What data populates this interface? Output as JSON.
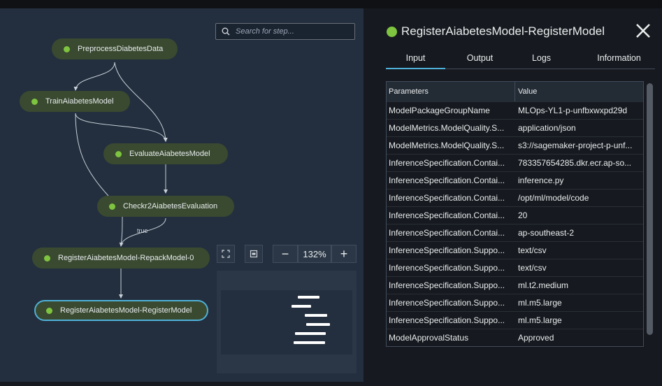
{
  "search": {
    "placeholder": "Search for step..."
  },
  "graph": {
    "nodes": [
      {
        "label": "PreprocessDiabetesData"
      },
      {
        "label": "TrainAiabetesModel"
      },
      {
        "label": "EvaluateAiabetesModel"
      },
      {
        "label": "Checkr2AiabetesEvaluation"
      },
      {
        "label": "RegisterAiabetesModel-RepackModel-0"
      },
      {
        "label": "RegisterAiabetesModel-RegisterModel"
      }
    ],
    "edge_label": "true",
    "status_color": "#7ec440",
    "selected_color": "#4fb0d8"
  },
  "controls": {
    "fit_icon": "fit-screen-icon",
    "center_icon": "center-icon",
    "zoom_out": "−",
    "zoom_value": "132%",
    "zoom_in": "+"
  },
  "panel": {
    "title": "RegisterAiabetesModel-RegisterModel",
    "status_icon": "success-dot",
    "close_icon": "close-icon",
    "tabs": [
      {
        "label": "Input",
        "active": true
      },
      {
        "label": "Output"
      },
      {
        "label": "Logs"
      },
      {
        "label": "Information"
      }
    ],
    "table": {
      "headers": [
        "Parameters",
        "Value"
      ],
      "rows": [
        [
          "ModelPackageGroupName",
          "MLOps-YL1-p-unfbxwxpd29d"
        ],
        [
          "ModelMetrics.ModelQuality.S...",
          "application/json"
        ],
        [
          "ModelMetrics.ModelQuality.S...",
          "s3://sagemaker-project-p-unf..."
        ],
        [
          "InferenceSpecification.Contai...",
          "783357654285.dkr.ecr.ap-so..."
        ],
        [
          "InferenceSpecification.Contai...",
          "inference.py"
        ],
        [
          "InferenceSpecification.Contai...",
          "/opt/ml/model/code"
        ],
        [
          "InferenceSpecification.Contai...",
          "20"
        ],
        [
          "InferenceSpecification.Contai...",
          "ap-southeast-2"
        ],
        [
          "InferenceSpecification.Suppo...",
          "text/csv"
        ],
        [
          "InferenceSpecification.Suppo...",
          "text/csv"
        ],
        [
          "InferenceSpecification.Suppo...",
          "ml.t2.medium"
        ],
        [
          "InferenceSpecification.Suppo...",
          "ml.m5.large"
        ],
        [
          "InferenceSpecification.Suppo...",
          "ml.m5.large"
        ],
        [
          "ModelApprovalStatus",
          "Approved"
        ]
      ]
    }
  }
}
